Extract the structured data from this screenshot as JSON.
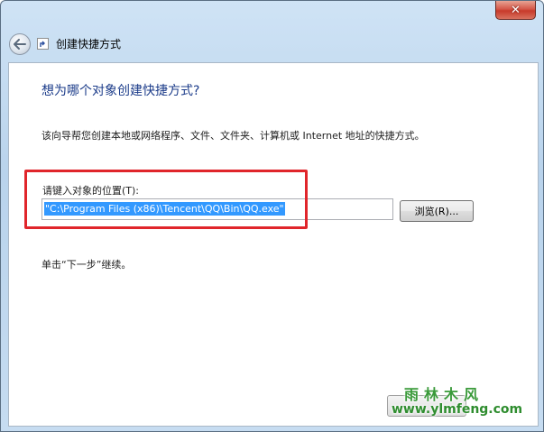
{
  "window": {
    "title": "创建快捷方式",
    "close_symbol": "✕"
  },
  "page": {
    "heading": "想为哪个对象创建快捷方式?",
    "description": "该向导帮您创建本地或网络程序、文件、文件夹、计算机或 Internet 地址的快捷方式。",
    "location_label": "请键入对象的位置(T):",
    "location_value": "\"C:\\Program Files (x86)\\Tencent\\QQ\\Bin\\QQ.exe\"",
    "browse_label": "浏览(R)...",
    "next_hint": "单击“下一步”继续。"
  },
  "watermark": {
    "name": "雨林木风",
    "url": "www.ylmfeng.com"
  },
  "colors": {
    "heading": "#1c3c8a",
    "highlight": "#e0252b",
    "selection": "#3399ff",
    "watermark": "#2f8d2f"
  },
  "icons": [
    "back-arrow-icon",
    "shortcut-icon",
    "close-icon"
  ]
}
